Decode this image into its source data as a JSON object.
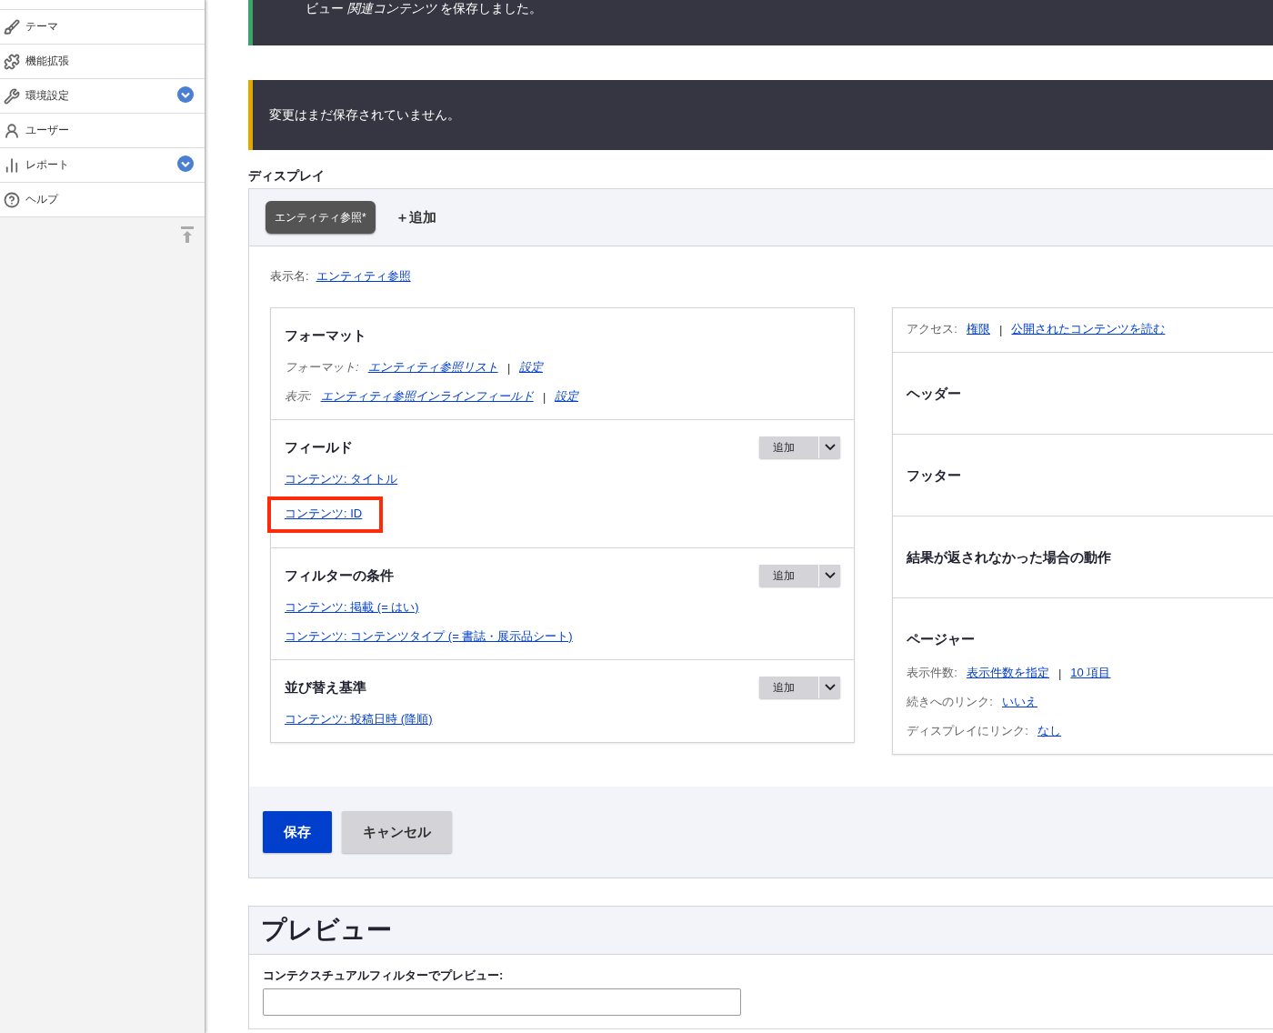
{
  "sidebar": {
    "items": [
      {
        "label": "テーマ",
        "expandable": false
      },
      {
        "label": "機能拡張",
        "expandable": false
      },
      {
        "label": "環境設定",
        "expandable": true
      },
      {
        "label": "ユーザー",
        "expandable": false
      },
      {
        "label": "レポート",
        "expandable": true
      },
      {
        "label": "ヘルプ",
        "expandable": false
      }
    ]
  },
  "messages": [
    {
      "kind": "status",
      "text": "ビュー *関連コンテンツ* を保存しました。"
    },
    {
      "kind": "warning",
      "text": "変更はまだ保存されていません。"
    }
  ],
  "display": {
    "heading": "ディスプレイ",
    "tabs": [
      {
        "label": "エンティティ参照*",
        "selected": true
      }
    ],
    "add_link": "＋追加",
    "display_name": {
      "label": "表示名:",
      "value": "エンティティ参照"
    },
    "left_sections": [
      {
        "title": "フォーマット",
        "rows": [
          {
            "italic": true,
            "parts": [
              {
                "kind": "label",
                "text": "フォーマット:"
              },
              {
                "kind": "link",
                "text": "エンティティ参照リスト"
              },
              {
                "kind": "sep",
                "text": "|"
              },
              {
                "kind": "link",
                "text": "設定"
              }
            ]
          },
          {
            "italic": true,
            "parts": [
              {
                "kind": "label",
                "text": "表示:"
              },
              {
                "kind": "link",
                "text": "エンティティ参照インラインフィールド"
              },
              {
                "kind": "sep",
                "text": "|"
              },
              {
                "kind": "link",
                "text": "設定"
              }
            ]
          }
        ]
      },
      {
        "title": "フィールド",
        "add_button": "追加",
        "rows": [
          {
            "italic": false,
            "highlighted": false,
            "parts": [
              {
                "kind": "link",
                "text": "コンテンツ: タイトル"
              }
            ]
          },
          {
            "italic": false,
            "highlighted": true,
            "parts": [
              {
                "kind": "link",
                "text": "コンテンツ: ID"
              }
            ]
          }
        ]
      },
      {
        "title": "フィルターの条件",
        "add_button": "追加",
        "rows": [
          {
            "italic": false,
            "highlighted": false,
            "parts": [
              {
                "kind": "link",
                "text": "コンテンツ: 掲載 (= はい)"
              }
            ]
          },
          {
            "italic": false,
            "highlighted": false,
            "parts": [
              {
                "kind": "link",
                "text": "コンテンツ: コンテンツタイプ (= 書誌・展示品シート)"
              }
            ]
          }
        ]
      },
      {
        "title": "並び替え基準",
        "add_button": "追加",
        "rows": [
          {
            "italic": false,
            "highlighted": false,
            "parts": [
              {
                "kind": "link",
                "text": "コンテンツ: 投稿日時 (降順)"
              }
            ]
          }
        ]
      }
    ],
    "right_sections": [
      {
        "rows": [
          {
            "italic": false,
            "parts": [
              {
                "kind": "label",
                "text": "アクセス:"
              },
              {
                "kind": "link",
                "text": "権限"
              },
              {
                "kind": "sep",
                "text": "|"
              },
              {
                "kind": "link",
                "text": "公開されたコンテンツを読む"
              }
            ]
          }
        ]
      },
      {
        "title": "ヘッダー"
      },
      {
        "title": "フッター"
      },
      {
        "title": "結果が返されなかった場合の動作"
      },
      {
        "title": "ページャー",
        "rows": [
          {
            "italic": false,
            "parts": [
              {
                "kind": "label",
                "text": "表示件数:"
              },
              {
                "kind": "link",
                "text": "表示件数を指定"
              },
              {
                "kind": "sep",
                "text": "|"
              },
              {
                "kind": "link",
                "text": "10 項目"
              }
            ]
          },
          {
            "italic": false,
            "parts": [
              {
                "kind": "label",
                "text": "続きへのリンク:"
              },
              {
                "kind": "link",
                "text": "いいえ"
              }
            ]
          },
          {
            "italic": false,
            "parts": [
              {
                "kind": "label",
                "text": "ディスプレイにリンク:"
              },
              {
                "kind": "link",
                "text": "なし"
              }
            ]
          }
        ]
      }
    ],
    "actions": [
      {
        "label": "保存",
        "kind": "primary"
      },
      {
        "label": "キャンセル",
        "kind": "secondary"
      }
    ]
  },
  "preview": {
    "title": "プレビュー",
    "field_label": "コンテクスチュアルフィルターでプレビュー:"
  }
}
